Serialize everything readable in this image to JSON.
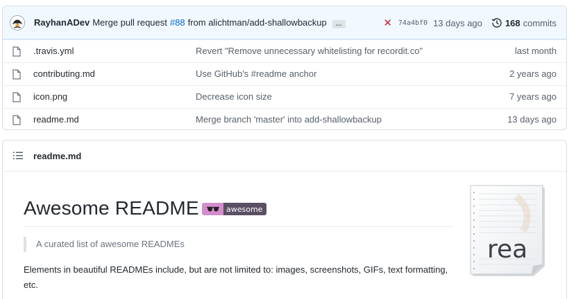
{
  "latest_commit": {
    "author": "RayhanADev",
    "message_prefix": "Merge pull request",
    "pr_number": "#88",
    "message_suffix": "from alichtman/add-shallowbackup",
    "ellipsis": "…",
    "sha": "74a4bf0",
    "age": "13 days ago",
    "commit_count": "168",
    "commit_count_label": "commits",
    "status": "failed",
    "status_color": "#cb2431"
  },
  "files": [
    {
      "name": ".travis.yml",
      "commit": "Revert \"Remove unnecessary whitelisting for recordit.co\"",
      "age": "last month",
      "icon": "file-icon"
    },
    {
      "name": "contributing.md",
      "commit": "Use GitHub's #readme anchor",
      "age": "2 years ago",
      "icon": "file-icon"
    },
    {
      "name": "icon.png",
      "commit": "Decrease icon size",
      "age": "7 years ago",
      "icon": "file-icon"
    },
    {
      "name": "readme.md",
      "commit": "Merge branch 'master' into add-shallowbackup",
      "age": "13 days ago",
      "icon": "file-icon"
    }
  ],
  "readme": {
    "header_title": "readme.md",
    "h1": "Awesome README",
    "badge_text": "awesome",
    "badge_colors": {
      "left": "#d48ccc",
      "right": "#5a4f63"
    },
    "blockquote": "A curated list of awesome READMEs",
    "paragraph": "Elements in beautiful READMEs include, but are not limited to: images, screenshots, GIFs, text formatting, etc.",
    "logo_text": "rea"
  },
  "colors": {
    "link": "#0366d6",
    "muted": "#586069",
    "commit_bar_bg": "#f1f8ff",
    "border": "#d8dee4"
  }
}
